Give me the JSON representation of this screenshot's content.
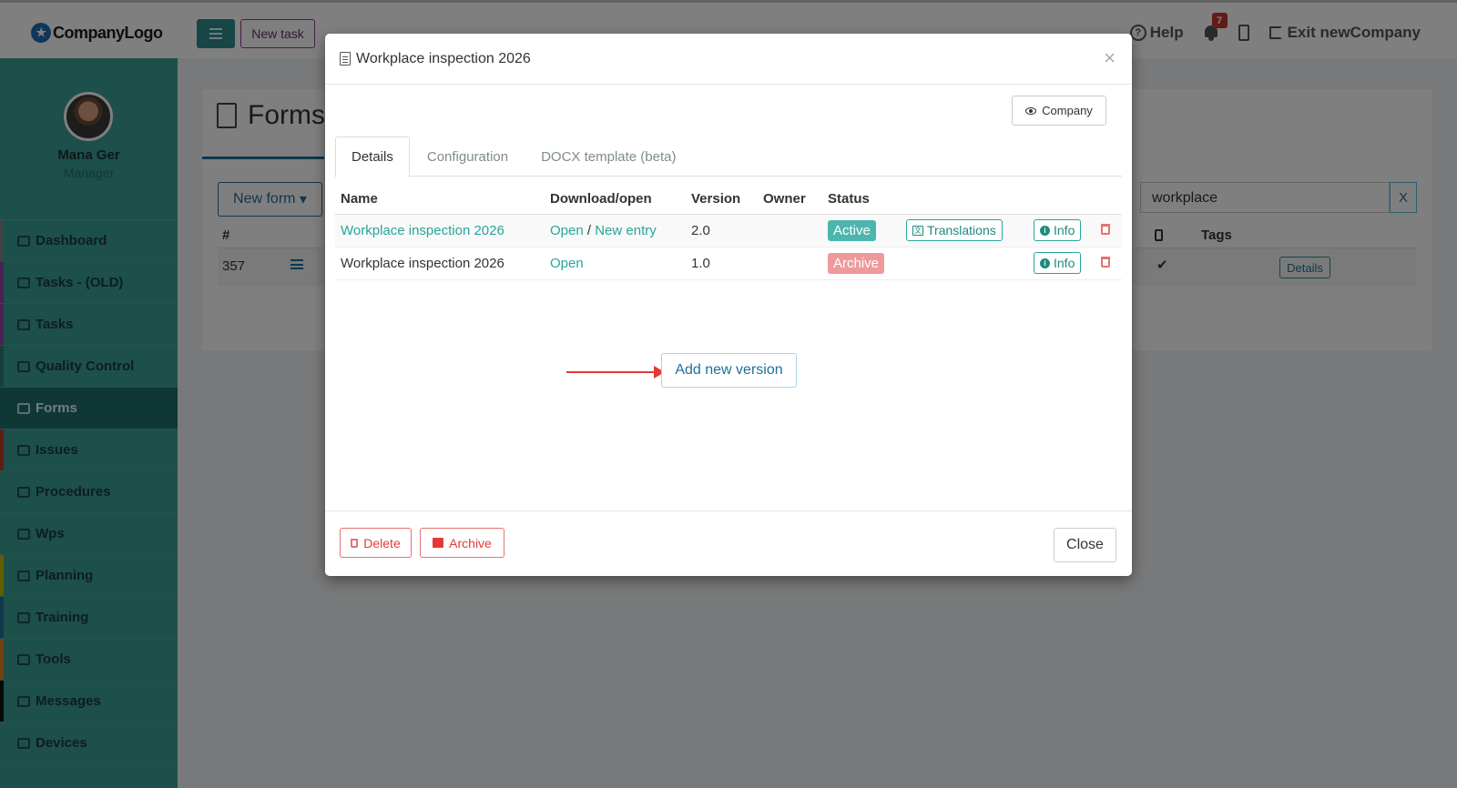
{
  "app": {
    "logo_text": "CompanyLogo",
    "new_task_label": "New task",
    "help_label": "Help",
    "notification_count": "7",
    "exit_label": "Exit newCompany"
  },
  "user": {
    "name": "Mana Ger",
    "role": "Manager"
  },
  "sidebar": {
    "items": [
      {
        "label": "Dashboard",
        "color": "#7a8b8b"
      },
      {
        "label": "Tasks - (OLD)",
        "color": "#8e44ad"
      },
      {
        "label": "Tasks",
        "color": "#8e44ad"
      },
      {
        "label": "Quality Control",
        "color": "#2e7d72"
      },
      {
        "label": "Forms",
        "color": "#1f6f6b"
      },
      {
        "label": "Issues",
        "color": "#c0392b"
      },
      {
        "label": "Procedures",
        "color": "#3a9e96"
      },
      {
        "label": "Wps",
        "color": "#3a9e96"
      },
      {
        "label": "Planning",
        "color": "#c9b800"
      },
      {
        "label": "Training",
        "color": "#1f6f9b"
      },
      {
        "label": "Tools",
        "color": "#e67e22"
      },
      {
        "label": "Messages",
        "color": "#111111"
      },
      {
        "label": "Devices",
        "color": "#3a9e96"
      }
    ]
  },
  "page": {
    "title": "Forms",
    "new_form_label": "New form",
    "search_value": "workplace",
    "search_clear": "X",
    "table_hash": "#",
    "table_tags": "Tags",
    "row_id": "357",
    "row_details": "Details"
  },
  "modal": {
    "title": "Workplace inspection 2026",
    "close_x": "×",
    "company_label": "Company",
    "tabs": [
      "Details",
      "Configuration",
      "DOCX template (beta)"
    ],
    "columns": [
      "Name",
      "Download/open",
      "Version",
      "Owner",
      "Status"
    ],
    "rows": [
      {
        "name": "Workplace inspection 2026",
        "open": "Open",
        "sep": "/",
        "new_entry": "New entry",
        "version": "2.0",
        "owner": "",
        "status": "Active",
        "translations": "Translations",
        "info": "Info"
      },
      {
        "name": "Workplace inspection 2026",
        "open": "Open",
        "version": "1.0",
        "owner": "",
        "status": "Archive",
        "info": "Info"
      }
    ],
    "add_version_label": "Add new version",
    "delete_label": "Delete",
    "archive_label": "Archive",
    "close_label": "Close"
  }
}
